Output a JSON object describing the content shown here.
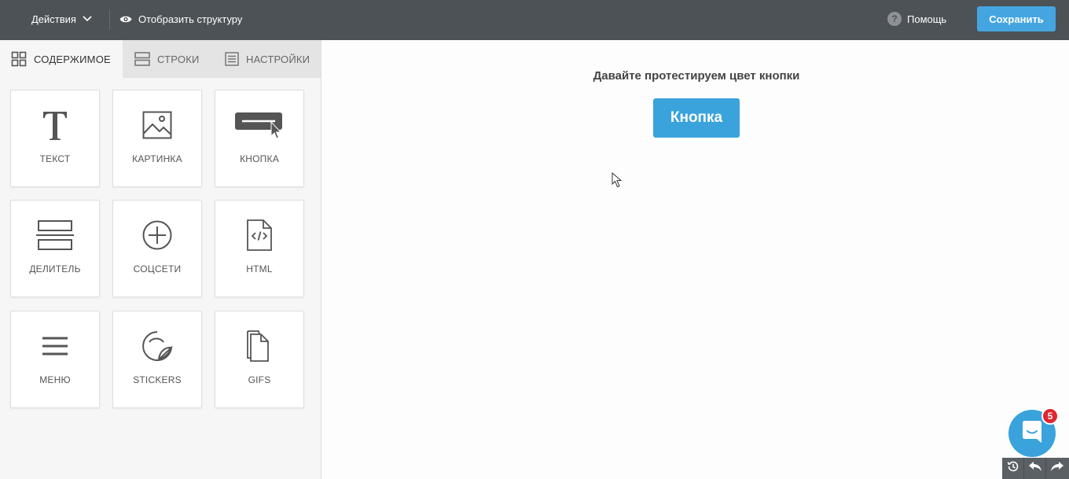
{
  "topbar": {
    "actions_label": "Действия",
    "structure_label": "Отобразить структуру",
    "help_label": "Помощь",
    "help_glyph": "?",
    "save_label": "Сохранить",
    "background": "#4d5256",
    "save_color": "#44a5e0"
  },
  "sidebar": {
    "tabs": [
      {
        "label": "СОДЕРЖИМОЕ",
        "icon": "grid-icon",
        "active": true
      },
      {
        "label": "СТРОКИ",
        "icon": "rows-icon",
        "active": false
      },
      {
        "label": "НАСТРОЙКИ",
        "icon": "settings-doc-icon",
        "active": false
      }
    ],
    "tiles": [
      {
        "label": "ТЕКСТ",
        "icon": "text-icon"
      },
      {
        "label": "КАРТИНКА",
        "icon": "image-icon"
      },
      {
        "label": "КНОПКА",
        "icon": "button-icon"
      },
      {
        "label": "ДЕЛИТЕЛЬ",
        "icon": "divider-icon"
      },
      {
        "label": "СОЦСЕТИ",
        "icon": "social-plus-icon"
      },
      {
        "label": "HTML",
        "icon": "html-file-icon"
      },
      {
        "label": "МЕНЮ",
        "icon": "menu-icon"
      },
      {
        "label": "STICKERS",
        "icon": "sticker-icon"
      },
      {
        "label": "GIFS",
        "icon": "gif-file-icon"
      }
    ]
  },
  "canvas": {
    "headline": "Давайте протестируем цвет кнопки",
    "button_label": "Кнопка",
    "button_color": "#3aa3dc"
  },
  "chat": {
    "badge_count": "5",
    "bubble_color": "#3aa3dc",
    "badge_color": "#e0262f"
  },
  "history": {
    "buttons": [
      "history-icon",
      "undo-icon",
      "redo-icon"
    ]
  }
}
